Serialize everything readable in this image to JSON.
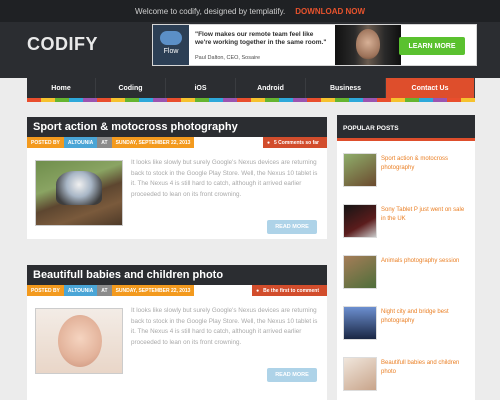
{
  "topbar": {
    "welcome": "Welcome to codify, designed by templatify.",
    "download": "DOWNLOAD NOW"
  },
  "header": {
    "logo": "CODIFY",
    "banner": {
      "brand": "Flow",
      "quote": "\"Flow makes our remote team feel like we're working together in the same room.\"",
      "author": "Paul Dalton, CEO, Sosaire",
      "button": "LEARN MORE"
    }
  },
  "nav": {
    "items": [
      "Home",
      "Coding",
      "iOS",
      "Android",
      "Business",
      "Contact Us"
    ]
  },
  "posts": [
    {
      "title": "Sport action & motocross photography",
      "posted_label": "POSTED BY",
      "author": "ALTOUNIA",
      "at": "AT",
      "date": "SUNDAY, SEPTEMBER 22, 2013",
      "comments": "5 Comments so far",
      "excerpt": "It looks like slowly but surely Google's Nexus devices are returning back to stock in the Google Play Store. Well, the Nexus 10 tablet is it. The Nexus 4 is still hard to catch, although it arrived earlier proceeded to lean on its front crowning.",
      "read_more": "READ MORE"
    },
    {
      "title": "Beautifull babies and children photo",
      "posted_label": "POSTED BY",
      "author": "ALTOUNIA",
      "at": "AT",
      "date": "SUNDAY, SEPTEMBER 22, 2013",
      "comments": "Be the first to comment",
      "excerpt": "It looks like slowly but surely Google's Nexus devices are returning back to stock in the Google Play Store. Well, the Nexus 10 tablet is it. The Nexus 4 is still hard to catch, although it arrived earlier proceeded to lean on its front crowning.",
      "read_more": "READ MORE"
    }
  ],
  "sidebar": {
    "title": "POPULAR POSTS",
    "items": [
      "Sport action & motocross photography",
      "Sony Tablet P just went on sale in the UK",
      "Animals photography session",
      "Night city and bridge best photography",
      "Beautifull babies and children photo"
    ]
  }
}
